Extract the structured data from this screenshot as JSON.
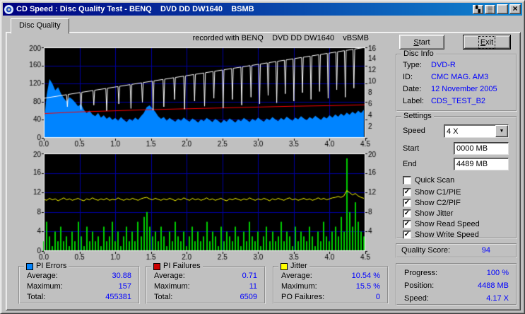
{
  "window": {
    "title": "CD Speed : Disc Quality Test - BENQ    DVD DD DW1640    BSMB",
    "buttons": {
      "extra1": "▚",
      "extra2": "▒",
      "minimize": "",
      "close": "×"
    }
  },
  "tab": {
    "label": "Disc Quality"
  },
  "chart_header": "recorded with BENQ    DVD DD DW1640    vBSMB",
  "icons": {
    "dropdown_arrow": "▼"
  },
  "actions": {
    "start": "Start",
    "exit": "Exit"
  },
  "disc_info": {
    "title": "Disc Info",
    "rows": [
      {
        "label": "Type:",
        "value": "DVD-R"
      },
      {
        "label": "ID:",
        "value": "CMC MAG. AM3"
      },
      {
        "label": "Date:",
        "value": "12 November 2005"
      },
      {
        "label": "Label:",
        "value": "CDS_TEST_B2"
      }
    ]
  },
  "settings": {
    "title": "Settings",
    "speed_label": "Speed",
    "speed_value": "4 X",
    "start_label": "Start",
    "start_value": "0000 MB",
    "end_label": "End",
    "end_value": "4489 MB",
    "checkboxes": [
      {
        "label": "Quick Scan",
        "mark": ""
      },
      {
        "label": "Show C1/PIE",
        "mark": "✓"
      },
      {
        "label": "Show C2/PIF",
        "mark": "✓"
      },
      {
        "label": "Show Jitter",
        "mark": "✓"
      },
      {
        "label": "Show Read Speed",
        "mark": "✓"
      },
      {
        "label": "Show Write Speed",
        "mark": "✓"
      }
    ]
  },
  "quality": {
    "label": "Quality Score:",
    "value": "94"
  },
  "progress": {
    "rows": [
      {
        "label": "Progress:",
        "value": "100 %"
      },
      {
        "label": "Position:",
        "value": "4488 MB"
      },
      {
        "label": "Speed:",
        "value": "4.17 X"
      }
    ]
  },
  "stats": [
    {
      "title": "PI Errors",
      "color": "#0084ff",
      "rows": [
        [
          "Average:",
          "30.88"
        ],
        [
          "Maximum:",
          "157"
        ],
        [
          "Total:",
          "455381"
        ]
      ]
    },
    {
      "title": "PI Failures",
      "color": "#cc0000",
      "rows": [
        [
          "Average:",
          "0.71"
        ],
        [
          "Maximum:",
          "11"
        ],
        [
          "Total:",
          "6509"
        ]
      ]
    },
    {
      "title": "Jitter",
      "color": "#ffff00",
      "rows": [
        [
          "Average:",
          "10.54 %"
        ],
        [
          "Maximum:",
          "15.5 %"
        ],
        [
          "PO Failures:",
          "0"
        ]
      ]
    }
  ],
  "chart_data": [
    {
      "type": "line",
      "title": "PI Errors with Read/Write Speed",
      "x_min": 0,
      "x_max": 4.5,
      "x_tick": 0.5,
      "left": {
        "min": 0,
        "max": 200,
        "tick": 40
      },
      "right": {
        "min": 0,
        "max": 16,
        "tick": 2
      },
      "grid_color": "#0000a0",
      "series": [
        {
          "name": "PI Errors",
          "style": "area",
          "axis": "left",
          "color": "#0084ff",
          "x0": 0,
          "x_step": 0.04,
          "values": [
            30,
            95,
            130,
            120,
            105,
            112,
            98,
            88,
            80,
            90,
            85,
            78,
            70,
            75,
            62,
            55,
            60,
            52,
            48,
            55,
            45,
            50,
            42,
            47,
            40,
            44,
            38,
            46,
            40,
            35,
            42,
            38,
            45,
            40,
            48,
            55,
            68,
            72,
            65,
            58,
            48,
            42,
            46,
            38,
            44,
            40,
            36,
            42,
            38,
            45,
            40,
            36,
            43,
            39,
            34,
            41,
            37,
            44,
            40,
            35,
            42,
            38,
            33,
            40,
            36,
            43,
            39,
            34,
            41,
            37,
            44,
            40,
            35,
            42,
            38,
            45,
            40,
            36,
            43,
            39,
            46,
            41,
            37,
            44,
            40,
            47,
            42,
            38,
            45,
            41,
            48,
            43,
            39,
            46,
            42,
            49,
            44,
            40,
            47,
            43,
            50,
            45,
            52,
            47,
            54,
            49,
            56,
            51,
            58,
            53,
            60,
            55,
            62
          ]
        },
        {
          "name": "Read Speed",
          "style": "line",
          "axis": "right",
          "color": "#ff0000",
          "points": [
            [
              0,
              4.3
            ],
            [
              0.5,
              4.6
            ],
            [
              1,
              4.8
            ],
            [
              1.5,
              5.0
            ],
            [
              2,
              5.15
            ],
            [
              2.5,
              5.3
            ],
            [
              3,
              5.45
            ],
            [
              3.5,
              5.6
            ],
            [
              4,
              5.7
            ],
            [
              4.5,
              5.85
            ]
          ]
        },
        {
          "name": "Write Speed",
          "style": "spikes",
          "axis": "right",
          "color": "#ffffff",
          "base": [
            7.0,
            16.0
          ],
          "spikes": [
            [
              0.33,
              5.5
            ],
            [
              0.52,
              5.0
            ],
            [
              0.7,
              5.8
            ],
            [
              0.88,
              4.8
            ],
            [
              1.05,
              6.0
            ],
            [
              1.22,
              5.2
            ],
            [
              1.38,
              6.3
            ],
            [
              1.53,
              4.9
            ],
            [
              1.68,
              5.5
            ],
            [
              1.83,
              6.8
            ],
            [
              1.97,
              5.1
            ],
            [
              2.11,
              6.5
            ],
            [
              2.25,
              5.6
            ],
            [
              2.38,
              7.0
            ],
            [
              2.51,
              5.3
            ],
            [
              2.64,
              6.8
            ],
            [
              2.77,
              5.8
            ],
            [
              2.9,
              7.2
            ],
            [
              3.02,
              6.0
            ],
            [
              3.14,
              7.5
            ],
            [
              3.26,
              6.2
            ],
            [
              3.38,
              7.8
            ],
            [
              3.5,
              6.5
            ],
            [
              3.62,
              8.0
            ],
            [
              3.74,
              6.8
            ],
            [
              3.86,
              8.2
            ],
            [
              3.98,
              7.0
            ],
            [
              4.1,
              8.5
            ],
            [
              4.22,
              7.2
            ],
            [
              4.34,
              8.8
            ]
          ]
        }
      ]
    },
    {
      "type": "line",
      "title": "PI Failures with Jitter",
      "x_min": 0,
      "x_max": 4.5,
      "x_tick": 0.5,
      "left": {
        "min": 0,
        "max": 20,
        "tick": 4
      },
      "right": {
        "min": 0,
        "max": 20,
        "tick": 4
      },
      "grid_color": "#0000a0",
      "series": [
        {
          "name": "PI Failures",
          "style": "bars",
          "axis": "left",
          "color": "#00cc00",
          "x0": 0,
          "x_step": 0.04,
          "values": [
            2,
            6,
            3,
            1,
            4,
            2,
            5,
            2,
            3,
            1,
            4,
            2,
            6,
            3,
            1,
            5,
            2,
            4,
            2,
            3,
            1,
            5,
            2,
            3,
            6,
            2,
            4,
            1,
            3,
            5,
            2,
            4,
            2,
            6,
            3,
            7,
            8,
            5,
            3,
            4,
            2,
            5,
            3,
            1,
            4,
            2,
            6,
            3,
            2,
            4,
            1,
            3,
            5,
            2,
            4,
            2,
            3,
            6,
            2,
            4,
            3,
            1,
            5,
            2,
            4,
            3,
            2,
            5,
            3,
            1,
            4,
            2,
            6,
            3,
            2,
            4,
            1,
            3,
            5,
            2,
            4,
            2,
            3,
            6,
            2,
            4,
            3,
            1,
            5,
            2,
            4,
            3,
            2,
            5,
            3,
            1,
            4,
            2,
            6,
            3,
            2,
            4,
            5,
            3,
            7,
            4,
            19,
            8,
            5,
            10,
            6,
            4,
            3
          ]
        },
        {
          "name": "Jitter",
          "style": "line",
          "axis": "left",
          "color": "#ffff00",
          "x0": 0,
          "x_step": 0.04,
          "values": [
            10.6,
            10.4,
            10.8,
            10.5,
            10.7,
            10.3,
            10.6,
            10.9,
            10.5,
            10.7,
            10.4,
            10.6,
            10.8,
            10.5,
            10.3,
            10.7,
            10.5,
            10.9,
            10.6,
            10.4,
            10.7,
            10.5,
            10.8,
            10.4,
            10.6,
            10.5,
            10.9,
            10.6,
            10.4,
            10.7,
            10.5,
            10.8,
            10.6,
            10.4,
            10.7,
            10.9,
            11.0,
            10.7,
            10.5,
            10.8,
            10.6,
            10.4,
            10.7,
            10.5,
            10.8,
            10.6,
            10.3,
            10.7,
            10.5,
            10.9,
            10.6,
            10.4,
            10.8,
            10.5,
            10.7,
            10.4,
            10.6,
            10.9,
            10.5,
            10.7,
            10.4,
            10.6,
            10.8,
            10.5,
            10.3,
            10.7,
            10.5,
            10.8,
            10.6,
            10.4,
            10.7,
            10.5,
            10.9,
            10.6,
            10.4,
            10.7,
            10.5,
            10.8,
            10.6,
            10.3,
            10.7,
            10.5,
            10.8,
            10.6,
            10.4,
            10.7,
            10.9,
            10.5,
            10.7,
            10.4,
            10.6,
            10.8,
            10.5,
            10.7,
            10.4,
            10.6,
            10.9,
            10.6,
            10.8,
            10.5,
            10.7,
            10.9,
            11.0,
            11.2,
            11.0,
            11.3,
            12.4,
            12.0,
            11.5,
            11.8,
            11.3,
            11.0,
            10.8
          ]
        }
      ]
    }
  ]
}
